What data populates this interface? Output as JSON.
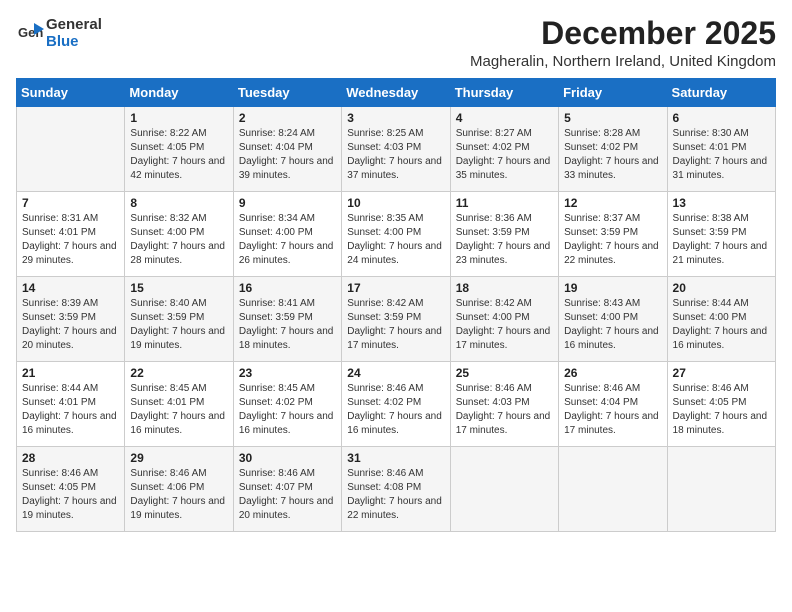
{
  "logo": {
    "general": "General",
    "blue": "Blue"
  },
  "title": "December 2025",
  "subtitle": "Magheralin, Northern Ireland, United Kingdom",
  "days_of_week": [
    "Sunday",
    "Monday",
    "Tuesday",
    "Wednesday",
    "Thursday",
    "Friday",
    "Saturday"
  ],
  "weeks": [
    [
      {
        "day": "",
        "sunrise": "",
        "sunset": "",
        "daylight": ""
      },
      {
        "day": "1",
        "sunrise": "Sunrise: 8:22 AM",
        "sunset": "Sunset: 4:05 PM",
        "daylight": "Daylight: 7 hours and 42 minutes."
      },
      {
        "day": "2",
        "sunrise": "Sunrise: 8:24 AM",
        "sunset": "Sunset: 4:04 PM",
        "daylight": "Daylight: 7 hours and 39 minutes."
      },
      {
        "day": "3",
        "sunrise": "Sunrise: 8:25 AM",
        "sunset": "Sunset: 4:03 PM",
        "daylight": "Daylight: 7 hours and 37 minutes."
      },
      {
        "day": "4",
        "sunrise": "Sunrise: 8:27 AM",
        "sunset": "Sunset: 4:02 PM",
        "daylight": "Daylight: 7 hours and 35 minutes."
      },
      {
        "day": "5",
        "sunrise": "Sunrise: 8:28 AM",
        "sunset": "Sunset: 4:02 PM",
        "daylight": "Daylight: 7 hours and 33 minutes."
      },
      {
        "day": "6",
        "sunrise": "Sunrise: 8:30 AM",
        "sunset": "Sunset: 4:01 PM",
        "daylight": "Daylight: 7 hours and 31 minutes."
      }
    ],
    [
      {
        "day": "7",
        "sunrise": "Sunrise: 8:31 AM",
        "sunset": "Sunset: 4:01 PM",
        "daylight": "Daylight: 7 hours and 29 minutes."
      },
      {
        "day": "8",
        "sunrise": "Sunrise: 8:32 AM",
        "sunset": "Sunset: 4:00 PM",
        "daylight": "Daylight: 7 hours and 28 minutes."
      },
      {
        "day": "9",
        "sunrise": "Sunrise: 8:34 AM",
        "sunset": "Sunset: 4:00 PM",
        "daylight": "Daylight: 7 hours and 26 minutes."
      },
      {
        "day": "10",
        "sunrise": "Sunrise: 8:35 AM",
        "sunset": "Sunset: 4:00 PM",
        "daylight": "Daylight: 7 hours and 24 minutes."
      },
      {
        "day": "11",
        "sunrise": "Sunrise: 8:36 AM",
        "sunset": "Sunset: 3:59 PM",
        "daylight": "Daylight: 7 hours and 23 minutes."
      },
      {
        "day": "12",
        "sunrise": "Sunrise: 8:37 AM",
        "sunset": "Sunset: 3:59 PM",
        "daylight": "Daylight: 7 hours and 22 minutes."
      },
      {
        "day": "13",
        "sunrise": "Sunrise: 8:38 AM",
        "sunset": "Sunset: 3:59 PM",
        "daylight": "Daylight: 7 hours and 21 minutes."
      }
    ],
    [
      {
        "day": "14",
        "sunrise": "Sunrise: 8:39 AM",
        "sunset": "Sunset: 3:59 PM",
        "daylight": "Daylight: 7 hours and 20 minutes."
      },
      {
        "day": "15",
        "sunrise": "Sunrise: 8:40 AM",
        "sunset": "Sunset: 3:59 PM",
        "daylight": "Daylight: 7 hours and 19 minutes."
      },
      {
        "day": "16",
        "sunrise": "Sunrise: 8:41 AM",
        "sunset": "Sunset: 3:59 PM",
        "daylight": "Daylight: 7 hours and 18 minutes."
      },
      {
        "day": "17",
        "sunrise": "Sunrise: 8:42 AM",
        "sunset": "Sunset: 3:59 PM",
        "daylight": "Daylight: 7 hours and 17 minutes."
      },
      {
        "day": "18",
        "sunrise": "Sunrise: 8:42 AM",
        "sunset": "Sunset: 4:00 PM",
        "daylight": "Daylight: 7 hours and 17 minutes."
      },
      {
        "day": "19",
        "sunrise": "Sunrise: 8:43 AM",
        "sunset": "Sunset: 4:00 PM",
        "daylight": "Daylight: 7 hours and 16 minutes."
      },
      {
        "day": "20",
        "sunrise": "Sunrise: 8:44 AM",
        "sunset": "Sunset: 4:00 PM",
        "daylight": "Daylight: 7 hours and 16 minutes."
      }
    ],
    [
      {
        "day": "21",
        "sunrise": "Sunrise: 8:44 AM",
        "sunset": "Sunset: 4:01 PM",
        "daylight": "Daylight: 7 hours and 16 minutes."
      },
      {
        "day": "22",
        "sunrise": "Sunrise: 8:45 AM",
        "sunset": "Sunset: 4:01 PM",
        "daylight": "Daylight: 7 hours and 16 minutes."
      },
      {
        "day": "23",
        "sunrise": "Sunrise: 8:45 AM",
        "sunset": "Sunset: 4:02 PM",
        "daylight": "Daylight: 7 hours and 16 minutes."
      },
      {
        "day": "24",
        "sunrise": "Sunrise: 8:46 AM",
        "sunset": "Sunset: 4:02 PM",
        "daylight": "Daylight: 7 hours and 16 minutes."
      },
      {
        "day": "25",
        "sunrise": "Sunrise: 8:46 AM",
        "sunset": "Sunset: 4:03 PM",
        "daylight": "Daylight: 7 hours and 17 minutes."
      },
      {
        "day": "26",
        "sunrise": "Sunrise: 8:46 AM",
        "sunset": "Sunset: 4:04 PM",
        "daylight": "Daylight: 7 hours and 17 minutes."
      },
      {
        "day": "27",
        "sunrise": "Sunrise: 8:46 AM",
        "sunset": "Sunset: 4:05 PM",
        "daylight": "Daylight: 7 hours and 18 minutes."
      }
    ],
    [
      {
        "day": "28",
        "sunrise": "Sunrise: 8:46 AM",
        "sunset": "Sunset: 4:05 PM",
        "daylight": "Daylight: 7 hours and 19 minutes."
      },
      {
        "day": "29",
        "sunrise": "Sunrise: 8:46 AM",
        "sunset": "Sunset: 4:06 PM",
        "daylight": "Daylight: 7 hours and 19 minutes."
      },
      {
        "day": "30",
        "sunrise": "Sunrise: 8:46 AM",
        "sunset": "Sunset: 4:07 PM",
        "daylight": "Daylight: 7 hours and 20 minutes."
      },
      {
        "day": "31",
        "sunrise": "Sunrise: 8:46 AM",
        "sunset": "Sunset: 4:08 PM",
        "daylight": "Daylight: 7 hours and 22 minutes."
      },
      {
        "day": "",
        "sunrise": "",
        "sunset": "",
        "daylight": ""
      },
      {
        "day": "",
        "sunrise": "",
        "sunset": "",
        "daylight": ""
      },
      {
        "day": "",
        "sunrise": "",
        "sunset": "",
        "daylight": ""
      }
    ]
  ]
}
